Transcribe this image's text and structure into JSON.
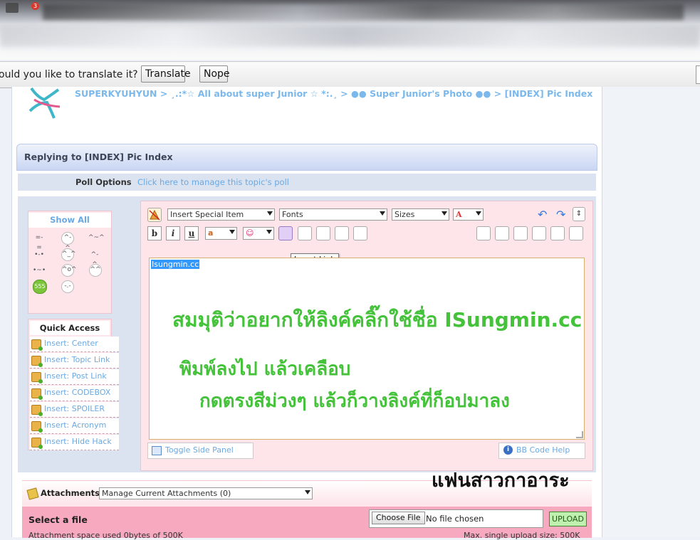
{
  "browser": {
    "tab_badge": "3"
  },
  "translate_bar": {
    "message": "ould you like to translate it?",
    "translate_label": "Translate",
    "nope_label": "Nope"
  },
  "breadcrumb": "SUPERKYUHYUN > ¸.:*☆ All about super Junior ☆ *:.¸ > ●● Super Junior's Photo ●● > [INDEX] Pic Index",
  "reply_header": "Replying to [INDEX] Pic Index",
  "poll": {
    "label": "Poll Options",
    "link": "Click here to manage this topic's poll"
  },
  "side_panel": {
    "show_all": "Show All",
    "emoticons": [
      "=-=",
      "^-^",
      "^~^",
      "•-•",
      "^_^",
      "^-^",
      "•~•",
      "^o^",
      "^^",
      "555",
      "-.-"
    ],
    "quick_access_title": "Quick Access",
    "quick_access": [
      "Insert: Center",
      "Insert: Topic Link",
      "Insert: Post Link",
      "Insert: CODEBOX",
      "Insert: SPOILER",
      "Insert: Acronym",
      "Insert: Hide Hack"
    ]
  },
  "editor": {
    "special_item": "Insert Special Item",
    "fonts": "Fonts",
    "sizes": "Sizes",
    "color_letter": "A",
    "bold": "b",
    "italic": "i",
    "underline": "u",
    "tooltip": "Insert Link",
    "selected_text": "Isungmin.cc",
    "annotation_1": "สมมุติว่าอยากให้ลิงค์คลิ๊กใช้ชื่อ ISungmin.cc",
    "annotation_2": "พิมพ์ลงไป แล้วเคลือบ",
    "annotation_3": "กดตรงสีม่วงๆ แล้วก็วางลิงค์ที่ก็อปมาลง",
    "toggle_side_panel": "Toggle Side Panel",
    "bb_code_help": "BB Code Help"
  },
  "watermark": "แฟนสาวกาอาระ",
  "attachments": {
    "label": "Attachments",
    "manage": "Manage Current Attachments (0)",
    "select_file": "Select a file",
    "choose_file": "Choose File",
    "no_file": "No file chosen",
    "upload": "UPLOAD",
    "space_used": "Attachment space used 0bytes of 500K",
    "max_single": "Max. single upload size: 500K"
  }
}
